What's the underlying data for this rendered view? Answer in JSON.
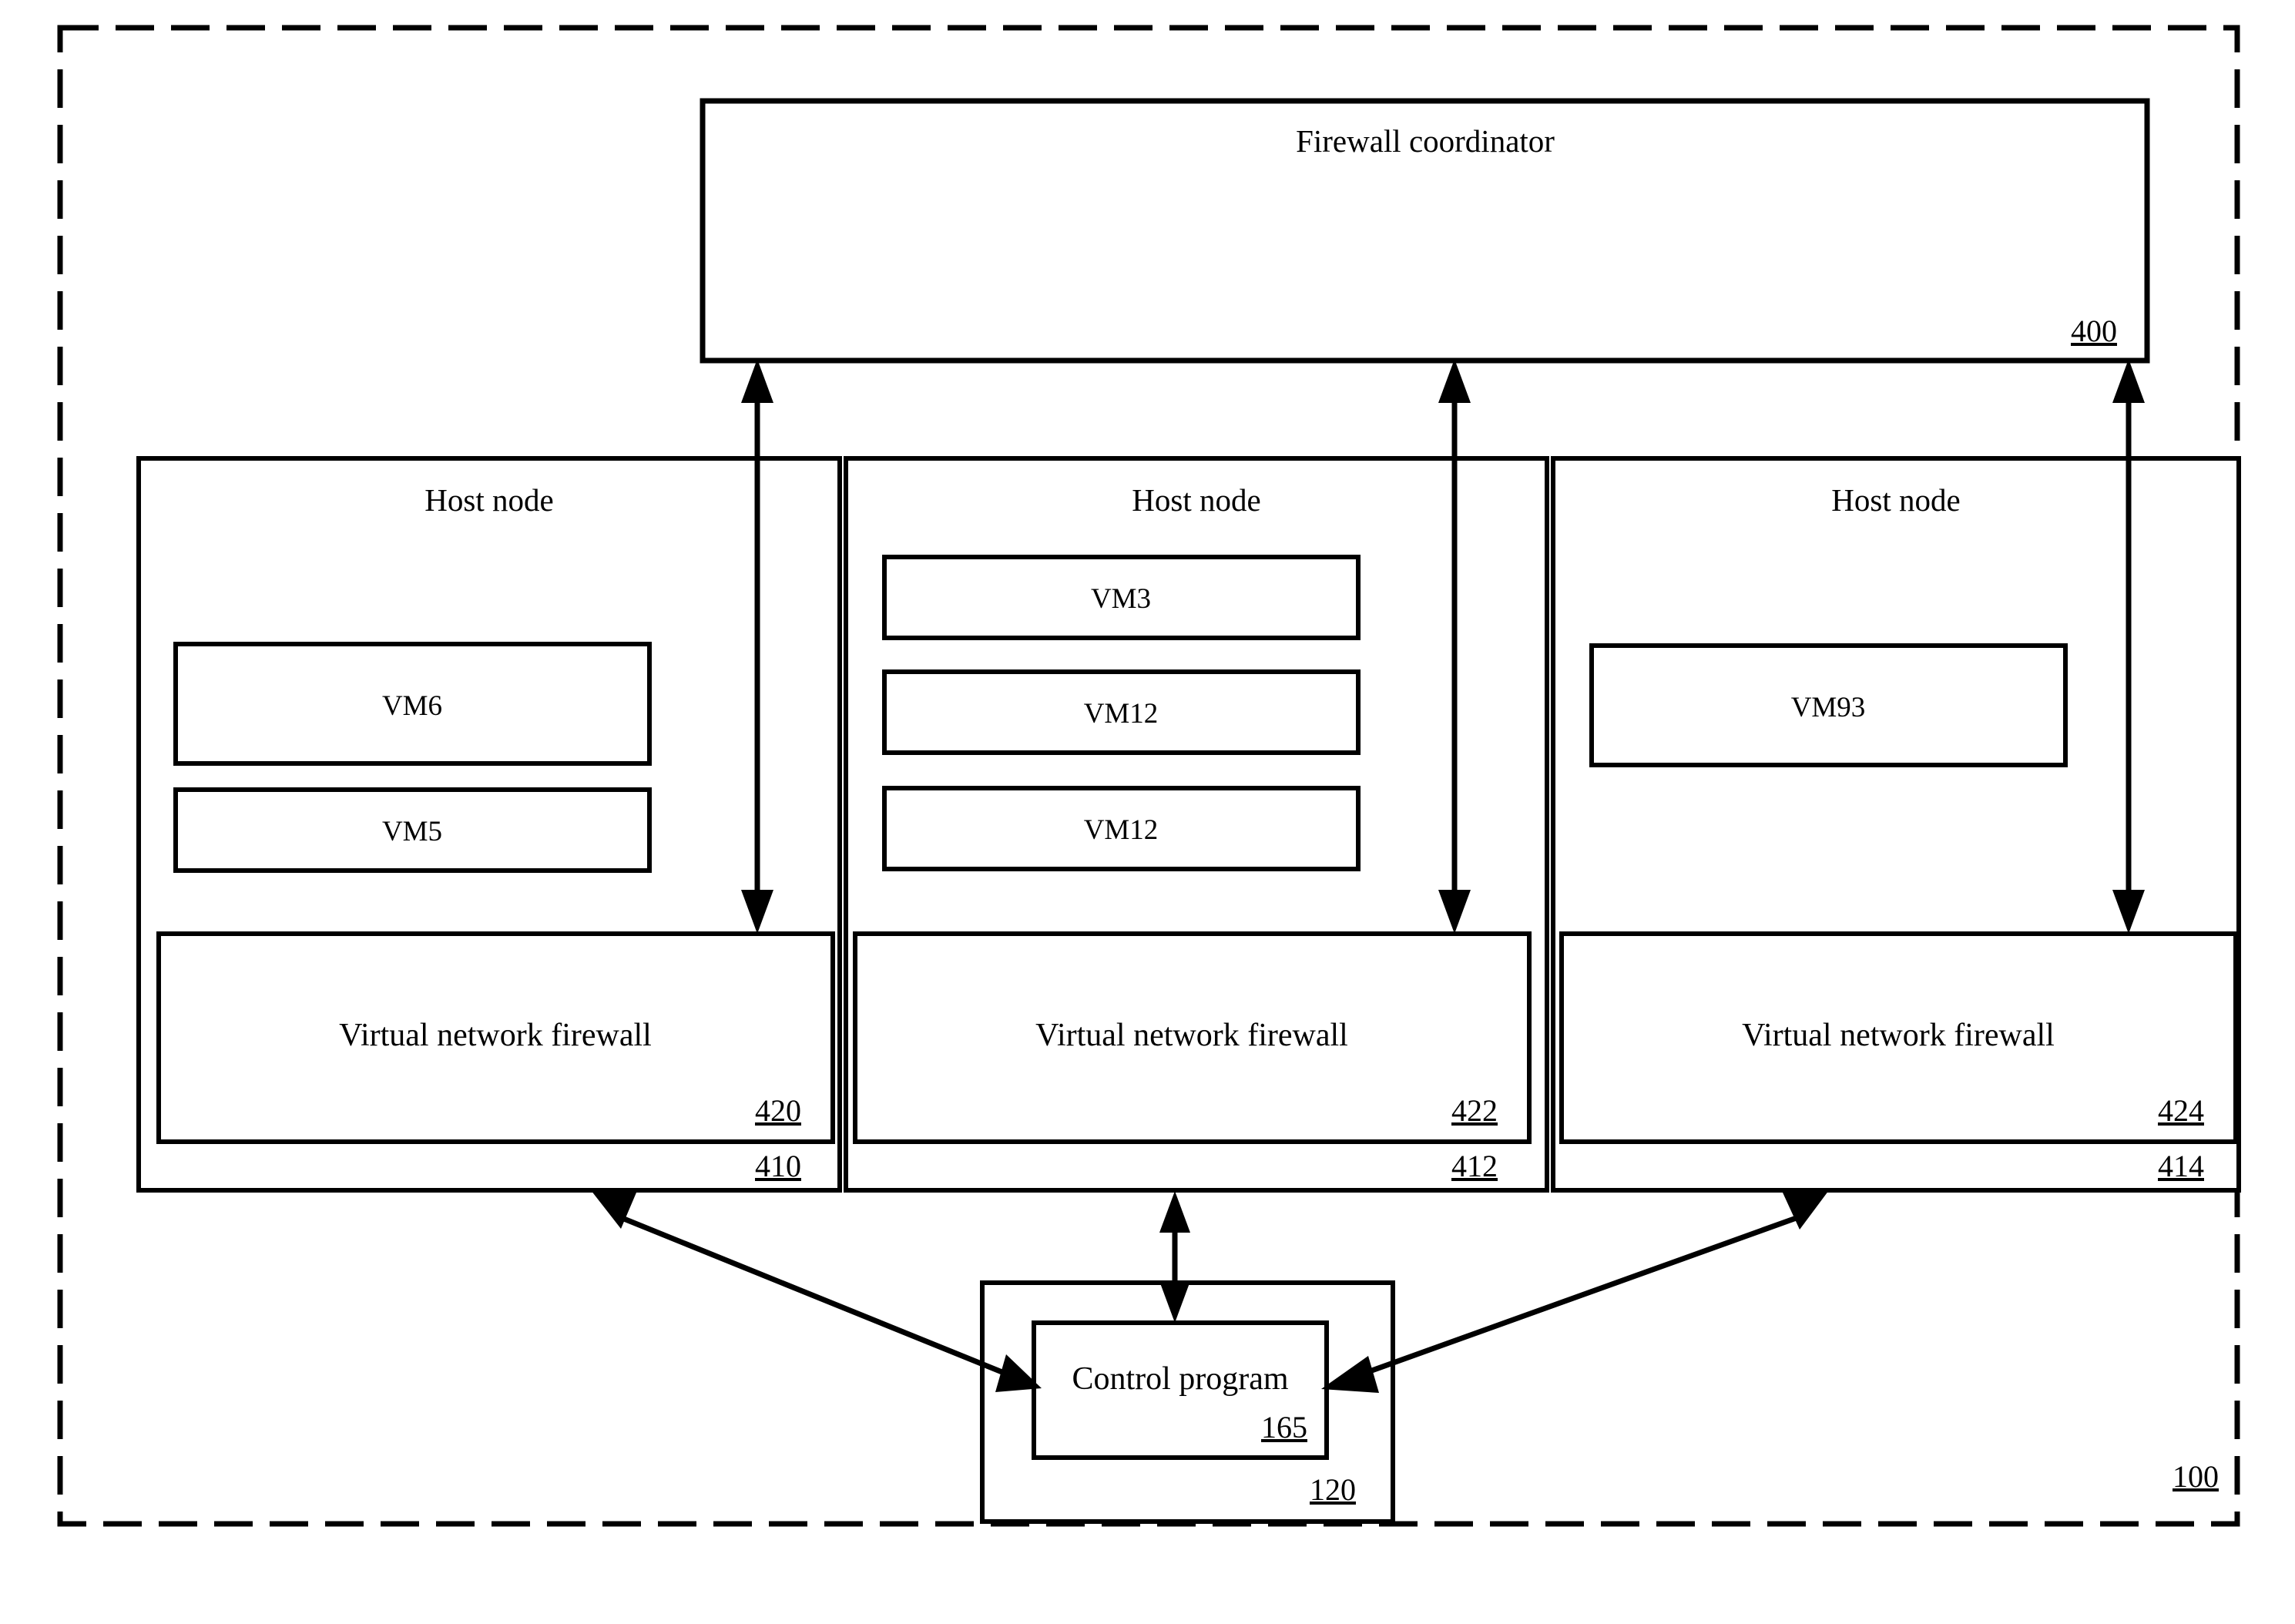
{
  "figure": {
    "system_ref": "100",
    "coordinator": {
      "title": "Firewall coordinator",
      "ref": "400"
    },
    "host_nodes": [
      {
        "title": "Host node",
        "ref": "410",
        "vms": [
          {
            "label": "VM6"
          },
          {
            "label": "VM5"
          }
        ],
        "firewall": {
          "label": "Virtual network firewall",
          "ref": "420"
        }
      },
      {
        "title": "Host node",
        "ref": "412",
        "vms": [
          {
            "label": "VM3"
          },
          {
            "label": "VM12"
          },
          {
            "label": "VM12"
          }
        ],
        "firewall": {
          "label": "Virtual network firewall",
          "ref": "422"
        }
      },
      {
        "title": "Host node",
        "ref": "414",
        "vms": [
          {
            "label": "VM93"
          }
        ],
        "firewall": {
          "label": "Virtual network firewall",
          "ref": "424"
        }
      }
    ],
    "controller": {
      "outer_ref": "120",
      "program": {
        "label": "Control program",
        "ref": "165"
      }
    },
    "colors": {
      "stroke": "#000000",
      "background": "#ffffff"
    }
  }
}
